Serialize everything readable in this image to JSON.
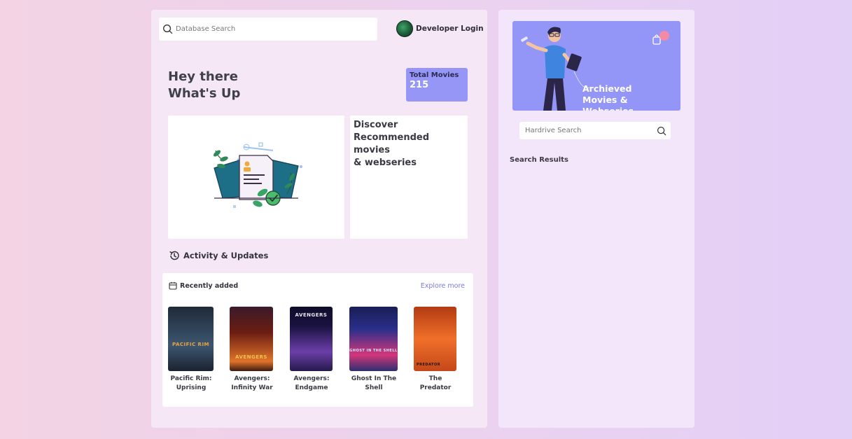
{
  "search": {
    "placeholder": "Database Search"
  },
  "header": {
    "login_label": "Developer Login"
  },
  "greeting": {
    "line1": "Hey there",
    "line2": "What's Up"
  },
  "stats": {
    "total_label": "Total Movies",
    "total_value": "215"
  },
  "discover": {
    "line1": "Discover",
    "line2": "Recommended movies",
    "line3": "& webseries"
  },
  "activity": {
    "label": "Activity & Updates"
  },
  "recent": {
    "label": "Recently added",
    "explore_label": "Explore more",
    "movies": [
      {
        "title": "Pacific Rim:\nUprising",
        "poster_text": "PACIFIC RIM",
        "colors": [
          "#1f2a38",
          "#3c5670"
        ]
      },
      {
        "title": "Avengers:\nInfinity War",
        "poster_text": "AVENGERS",
        "colors": [
          "#6b1d12",
          "#e0742a"
        ]
      },
      {
        "title": "Avengers:\nEndgame",
        "poster_text": "AVENGERS",
        "colors": [
          "#1a1240",
          "#6b3ea8"
        ]
      },
      {
        "title": "Ghost In The\nShell",
        "poster_text": "GHOST IN THE SHELL",
        "colors": [
          "#2a2f8a",
          "#d2377a"
        ]
      },
      {
        "title": "The\nPredator",
        "poster_text": "PREDATOR",
        "colors": [
          "#b23a12",
          "#f0702a"
        ]
      }
    ]
  },
  "banner": {
    "line1": "Archieved",
    "line2": "Movies & Webseries"
  },
  "hardrive": {
    "placeholder": "Hardrive Search"
  },
  "results": {
    "label": "Search Results"
  },
  "colors": {
    "accent": "#9596f6",
    "link": "#7b7bd9"
  }
}
